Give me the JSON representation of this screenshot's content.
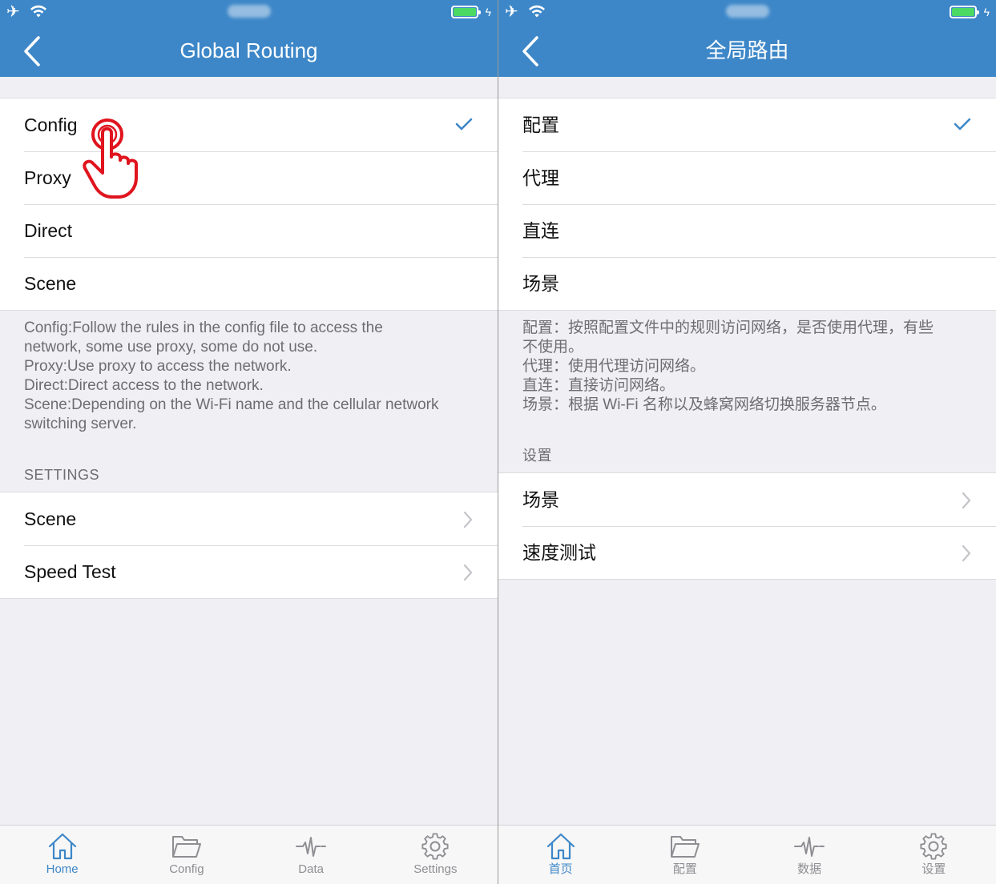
{
  "left": {
    "status": {
      "airplane_icon": "airplane-icon",
      "wifi_icon": "wifi-icon",
      "battery_icon": "battery-charging-icon"
    },
    "navbar": {
      "title": "Global Routing",
      "back_icon": "chevron-left-icon"
    },
    "routing_options": [
      {
        "label": "Config",
        "selected": true
      },
      {
        "label": "Proxy",
        "selected": false
      },
      {
        "label": "Direct",
        "selected": false
      },
      {
        "label": "Scene",
        "selected": false
      }
    ],
    "description_lines": [
      "Config:Follow the rules in the config file to access the",
      "network, some use proxy, some do not use.",
      "Proxy:Use proxy to access the network.",
      "Direct:Direct access to the network.",
      "Scene:Depending on the Wi-Fi name and the cellular network",
      "switching server."
    ],
    "settings_header": "SETTINGS",
    "settings_items": [
      {
        "label": "Scene"
      },
      {
        "label": "Speed Test"
      }
    ],
    "tabs": [
      {
        "label": "Home",
        "icon": "home-icon",
        "active": true
      },
      {
        "label": "Config",
        "icon": "folder-icon",
        "active": false
      },
      {
        "label": "Data",
        "icon": "pulse-icon",
        "active": false
      },
      {
        "label": "Settings",
        "icon": "gear-icon",
        "active": false
      }
    ],
    "annotation_icon": "tap-hand-icon"
  },
  "right": {
    "status": {
      "airplane_icon": "airplane-icon",
      "wifi_icon": "wifi-icon",
      "battery_icon": "battery-charging-icon"
    },
    "navbar": {
      "title": "全局路由",
      "back_icon": "chevron-left-icon"
    },
    "routing_options": [
      {
        "label": "配置",
        "selected": true
      },
      {
        "label": "代理",
        "selected": false
      },
      {
        "label": "直连",
        "selected": false
      },
      {
        "label": "场景",
        "selected": false
      }
    ],
    "description_lines": [
      "配置：按照配置文件中的规则访问网络，是否使用代理，有些",
      "不使用。",
      "代理：使用代理访问网络。",
      "直连：直接访问网络。",
      "场景：根据 Wi-Fi 名称以及蜂窝网络切换服务器节点。"
    ],
    "settings_header": "设置",
    "settings_items": [
      {
        "label": "场景"
      },
      {
        "label": "速度测试"
      }
    ],
    "tabs": [
      {
        "label": "首页",
        "icon": "home-icon",
        "active": true
      },
      {
        "label": "配置",
        "icon": "folder-icon",
        "active": false
      },
      {
        "label": "数据",
        "icon": "pulse-icon",
        "active": false
      },
      {
        "label": "设置",
        "icon": "gear-icon",
        "active": false
      }
    ]
  },
  "colors": {
    "accent": "#3d87c8",
    "background": "#efeff4",
    "checkmark": "#3d87c8",
    "hand_outline": "#e0141e"
  }
}
